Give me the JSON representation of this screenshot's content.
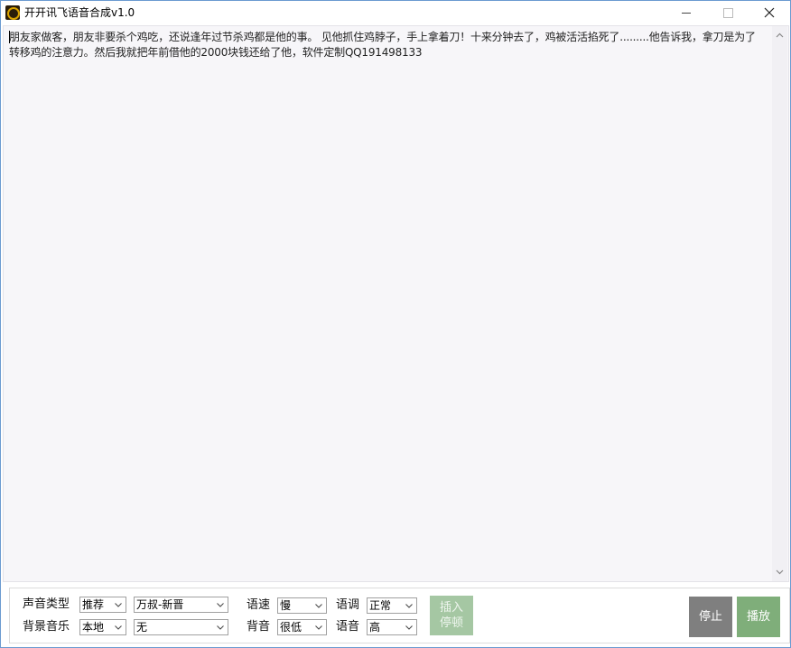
{
  "window": {
    "title": "开开讯飞语音合成v1.0",
    "icons": {
      "app": "app-logo-icon",
      "minimize": "minimize-icon",
      "maximize": "maximize-icon",
      "close": "close-icon"
    }
  },
  "editor": {
    "text": "朋友家做客，朋友非要杀个鸡吃，还说逢年过节杀鸡都是他的事。 见他抓住鸡脖子，手上拿着刀！十来分钟去了，鸡被活活掐死了.........他告诉我，拿刀是为了转移鸡的注意力。然后我就把年前借他的2000块钱还给了他，软件定制QQ191498133"
  },
  "controls": {
    "voice_type_label": "声音类型",
    "voice_category": "推荐",
    "voice_name": "万叔-新晋",
    "bg_music_label": "背景音乐",
    "bg_music_source": "本地",
    "bg_music_file": "无",
    "speed_label": "语速",
    "speed_value": "慢",
    "pitch_label": "语调",
    "pitch_value": "正常",
    "bg_volume_label": "背音",
    "bg_volume_value": "很低",
    "voice_volume_label": "语音",
    "voice_volume_value": "高",
    "insert_pause_line1": "插入",
    "insert_pause_line2": "停顿",
    "stop_label": "停止",
    "play_label": "播放"
  },
  "colors": {
    "accent_play": "#7fae7a",
    "stop_button": "#7f7f7f",
    "insert_disabled": "#a5c7a3",
    "editor_bg": "#f7f6f9"
  }
}
